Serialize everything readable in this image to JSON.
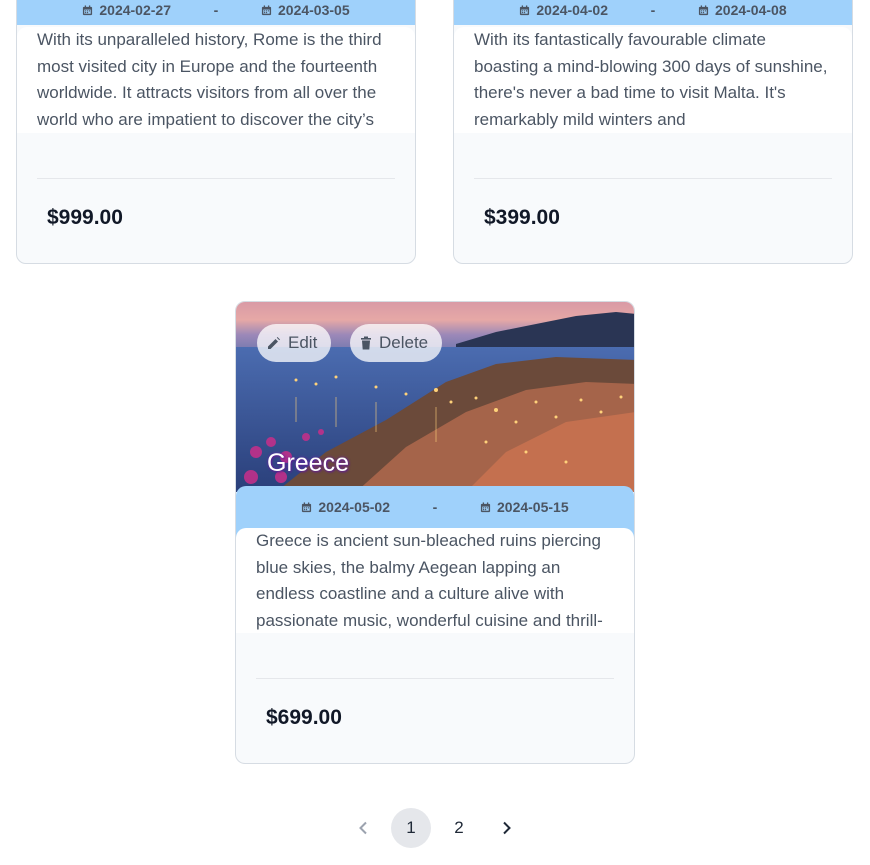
{
  "cards": [
    {
      "start_date": "2024-02-27",
      "separator": "-",
      "end_date": "2024-03-05",
      "description": "With its unparalleled history, Rome is the third most visited city in Europe and the fourteenth worldwide. It attracts visitors from all over the world who are impatient to discover the city’s",
      "price": "$999.00"
    },
    {
      "start_date": "2024-04-02",
      "separator": "-",
      "end_date": "2024-04-08",
      "description": "With its fantastically favourable climate boasting a mind-blowing 300 days of sunshine, there's never a bad time to visit Malta. It's remarkably mild winters and",
      "price": "$399.00"
    },
    {
      "title": "Greece",
      "edit_label": "Edit",
      "delete_label": "Delete",
      "start_date": "2024-05-02",
      "separator": "-",
      "end_date": "2024-05-15",
      "description": "Greece is ancient sun-bleached ruins piercing blue skies, the balmy Aegean lapping an endless coastline and a culture alive with passionate music, wonderful cuisine and thrill-",
      "price": "$699.00"
    }
  ],
  "pagination": {
    "pages": [
      "1",
      "2"
    ],
    "current": "1"
  },
  "icons": {
    "calendar": "calendar-icon",
    "edit": "pencil-icon",
    "delete": "trash-icon",
    "prev": "chevron-left-icon",
    "next": "chevron-right-icon"
  },
  "colors": {
    "date_band": "#9fd1fb",
    "card_border": "#d6dce3",
    "active_page": "#e5e7eb"
  }
}
